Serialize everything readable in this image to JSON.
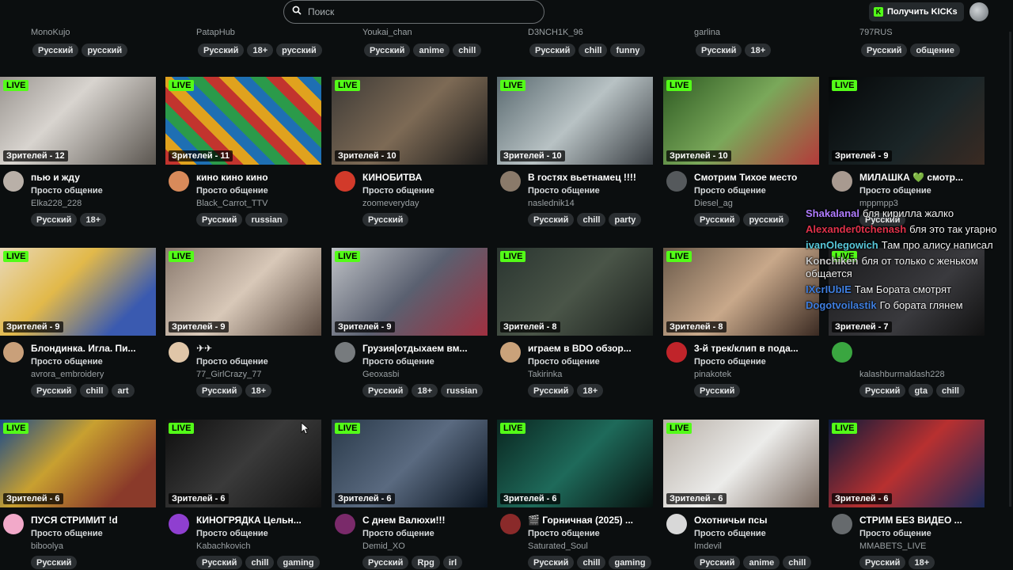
{
  "search": {
    "placeholder": "Поиск"
  },
  "header": {
    "kicks_label": "Получить KICKs"
  },
  "top_row": [
    {
      "username": "MonoKujo",
      "tags": [
        "Русский",
        "русский"
      ]
    },
    {
      "username": "PatapHub",
      "tags": [
        "Русский",
        "18+",
        "русский"
      ]
    },
    {
      "username": "Youkai_chan",
      "tags": [
        "Русский",
        "anime",
        "chill"
      ]
    },
    {
      "username": "D3NCH1K_96",
      "tags": [
        "Русский",
        "chill",
        "funny"
      ]
    },
    {
      "username": "garlina",
      "tags": [
        "Русский",
        "18+"
      ]
    },
    {
      "username": "797RUS",
      "tags": [
        "Русский",
        "общение"
      ]
    }
  ],
  "live_label": "LIVE",
  "streams": [
    {
      "viewers": "Зрителей - 12",
      "title": "пью и жду",
      "category": "Просто общение",
      "username": "Elka228_228",
      "tags": [
        "Русский",
        "18+"
      ],
      "avatar_color": "#b9b0a8"
    },
    {
      "viewers": "Зрителей - 11",
      "title": "кино кино кино",
      "category": "Просто общение",
      "username": "Black_Carrot_TTV",
      "tags": [
        "Русский",
        "russian"
      ],
      "avatar_color": "#d88a5a"
    },
    {
      "viewers": "Зрителей - 10",
      "title": "КИНОБИТВА",
      "category": "Просто общение",
      "username": "zoomeveryday",
      "tags": [
        "Русский"
      ],
      "avatar_color": "#d23a2a"
    },
    {
      "viewers": "Зрителей - 10",
      "title": "В гостях вьетнамец !!!!",
      "category": "Просто общение",
      "username": "naslednik14",
      "tags": [
        "Русский",
        "chill",
        "party"
      ],
      "avatar_color": "#8a7a6a"
    },
    {
      "viewers": "Зрителей - 10",
      "title": "Смотрим Тихое место",
      "category": "Просто общение",
      "username": "Diesel_ag",
      "tags": [
        "Русский",
        "русский"
      ],
      "avatar_color": "#55595c"
    },
    {
      "viewers": "Зрителей - 9",
      "title": "МИЛАШКА 💚 смотр...",
      "category": "Просто общение",
      "username": "mppmpp3",
      "tags": [
        "Русский"
      ],
      "avatar_color": "#a89a90"
    },
    {
      "viewers": "Зрителей - 9",
      "title": "Блондинка. Игла. Пи...",
      "category": "Просто общение",
      "username": "avrora_embroidery",
      "tags": [
        "Русский",
        "chill",
        "art"
      ],
      "avatar_color": "#c9a07a"
    },
    {
      "viewers": "Зрителей - 9",
      "title": "✈✈",
      "category": "Просто общение",
      "username": "77_GirlCrazy_77",
      "tags": [
        "Русский",
        "18+"
      ],
      "avatar_color": "#e0c6a8"
    },
    {
      "viewers": "Зрителей - 9",
      "title": "Грузия|отдыхаем вм...",
      "category": "Просто общение",
      "username": "Geoxasbi",
      "tags": [
        "Русский",
        "18+",
        "russian"
      ],
      "avatar_color": "#777b7e"
    },
    {
      "viewers": "Зрителей - 8",
      "title": "играем в BDO обзор...",
      "category": "Просто общение",
      "username": "Takirinka",
      "tags": [
        "Русский",
        "18+"
      ],
      "avatar_color": "#caa27a"
    },
    {
      "viewers": "Зрителей - 8",
      "title": "3-й трек/клип в пода...",
      "category": "Просто общение",
      "username": "pinakotek",
      "tags": [
        "Русский"
      ],
      "avatar_color": "#c0242a"
    },
    {
      "viewers": "Зрителей - 7",
      "title": "",
      "category": "",
      "username": "kalashburmaldash228",
      "tags": [
        "Русский",
        "gta",
        "chill"
      ],
      "avatar_color": "#3aa640"
    },
    {
      "viewers": "Зрителей - 6",
      "title": "ПУСЯ СТРИМИТ !d",
      "category": "Просто общение",
      "username": "biboolya",
      "tags": [
        "Русский"
      ],
      "avatar_color": "#f2a9c9"
    },
    {
      "viewers": "Зрителей - 6",
      "title": "КИНОГРЯДКА Цельн...",
      "category": "Просто общение",
      "username": "Kabachkovich",
      "tags": [
        "Русский",
        "chill",
        "gaming"
      ],
      "avatar_color": "#8f3fd0"
    },
    {
      "viewers": "Зрителей - 6",
      "title": "С днем Валюхи!!!",
      "category": "Просто общение",
      "username": "Demid_XO",
      "tags": [
        "Русский",
        "Rpg",
        "irl"
      ],
      "avatar_color": "#7a2a6a"
    },
    {
      "viewers": "Зрителей - 6",
      "title": "🎬 Горничная (2025) ...",
      "category": "Просто общение",
      "username": "Saturated_Soul",
      "tags": [
        "Русский",
        "chill",
        "gaming"
      ],
      "avatar_color": "#8a2a2a"
    },
    {
      "viewers": "Зрителей - 6",
      "title": "Охотничьи псы",
      "category": "Просто общение",
      "username": "Imdevil",
      "tags": [
        "Русский",
        "anime",
        "chill"
      ],
      "avatar_color": "#d8d8d8"
    },
    {
      "viewers": "Зрителей - 6",
      "title": "СТРИМ БЕЗ ВИДЕО ...",
      "category": "Просто общение",
      "username": "MMABETS_LIVE",
      "tags": [
        "Русский",
        "18+"
      ],
      "avatar_color": "#666a6d"
    }
  ],
  "chat": [
    {
      "nick": "Shakalanal",
      "text": "бля кирилла жалко",
      "color": "#b07cff"
    },
    {
      "nick": "Alexander0tchenash",
      "text": "бля это так угарно",
      "color": "#e0324a"
    },
    {
      "nick": "ivanOlegowich",
      "text": "Там про алису написал",
      "color": "#57c7d9"
    },
    {
      "nick": "Konchiken",
      "text": "бля от только с женьком общается",
      "color": "#c8c8c8"
    },
    {
      "nick": "IXcrIUbIE",
      "text": "Там Бората смотрят",
      "color": "#3f7fe0"
    },
    {
      "nick": "Dogotvoilastik",
      "text": "Го бората глянем",
      "color": "#3f7fe0"
    }
  ]
}
